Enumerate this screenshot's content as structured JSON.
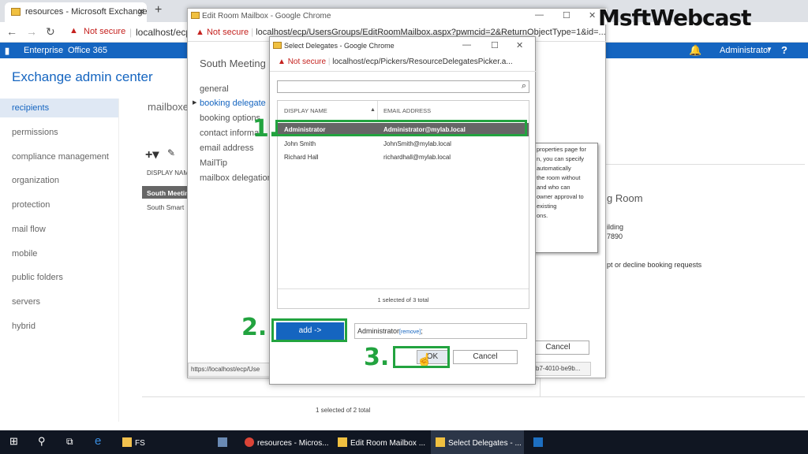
{
  "brand": "MsftWebcast",
  "browser": {
    "tab_title": "resources - Microsoft Exchange",
    "not_secure": "Not secure",
    "url": "localhost/ecp/"
  },
  "exchange": {
    "nav_enterprise": "Enterprise",
    "nav_office365": "Office 365",
    "admin_user": "Administrator",
    "help": "?",
    "title": "Exchange admin center",
    "left_nav": [
      "recipients",
      "permissions",
      "compliance management",
      "organization",
      "protection",
      "mail flow",
      "mobile",
      "public folders",
      "servers",
      "hybrid"
    ],
    "tab_label": "mailboxe",
    "list_header": "DISPLAY NAM",
    "list_rows": [
      "South Meetin",
      "South Smart"
    ],
    "bottom_status": "1 selected of 2 total",
    "right_title": "g Room",
    "right_lines": [
      "ilding",
      "7890",
      "pt or decline booking requests"
    ]
  },
  "edit_window": {
    "title": "Edit Room Mailbox - Google Chrome",
    "not_secure": "Not secure",
    "url": "localhost/ecp/UsersGroups/EditRoomMailbox.aspx?pwmcid=2&ReturnObjectType=1&id=...",
    "room_name": "South Meeting",
    "nav": [
      "general",
      "booking delegate",
      "booking options",
      "contact informa",
      "email address",
      "MailTip",
      "mailbox delegation"
    ],
    "tooltip_lines": [
      "properties page for",
      "n, you can specify",
      "automatically",
      "the room without",
      "and who can",
      "owner approval to",
      "existing",
      "ons."
    ],
    "status_left": "https://localhost/ecp/Use",
    "status_right": "b7-4010-be9b...",
    "cancel": "Cancel"
  },
  "delegates_window": {
    "title": "Select Delegates - Google Chrome",
    "not_secure": "Not secure",
    "url": "localhost/ecp/Pickers/ResourceDelegatesPicker.a...",
    "col_name": "DISPLAY NAME",
    "col_email": "EMAIL ADDRESS",
    "rows": [
      {
        "name": "Administrator",
        "email": "Administrator@mylab.local"
      },
      {
        "name": "John Smith",
        "email": "JohnSmith@mylab.local"
      },
      {
        "name": "Richard Hall",
        "email": "richardhall@mylab.local"
      }
    ],
    "count": "1 selected of 3 total",
    "add_button": "add ->",
    "added_value": "Administrator",
    "remove_link": "[remove]",
    "added_suffix": ";",
    "ok": "OK",
    "cancel": "Cancel"
  },
  "annotations": [
    "1.",
    "2.",
    "3."
  ],
  "taskbar": {
    "fs": "FS",
    "items": [
      "resources - Micros...",
      "Edit Room Mailbox ...",
      "Select Delegates - ..."
    ]
  }
}
